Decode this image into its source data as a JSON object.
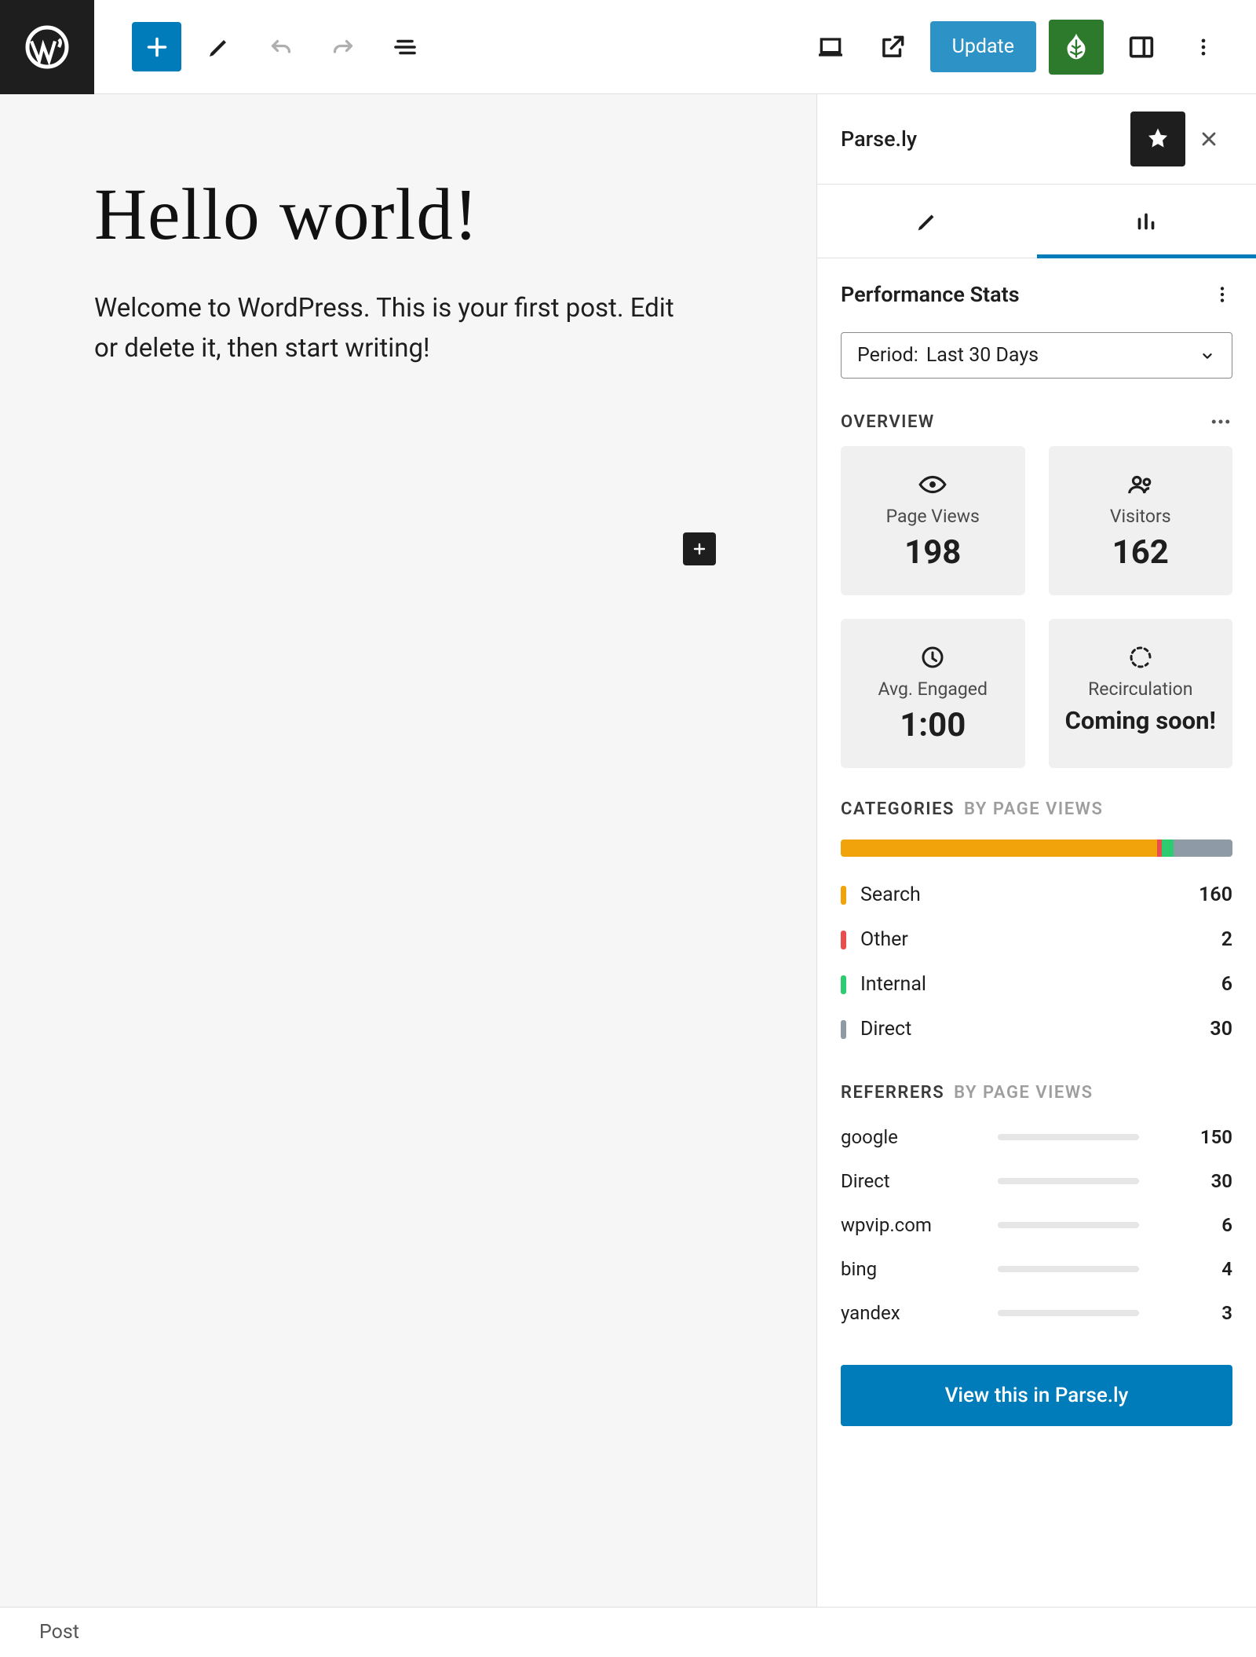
{
  "topbar": {
    "update_label": "Update"
  },
  "editor": {
    "title": "Hello world!",
    "body": "Welcome to WordPress. This is your first post. Edit or delete it, then start writing!"
  },
  "sidebar": {
    "title": "Parse.ly",
    "section_title": "Performance Stats",
    "period_label": "Period:",
    "period_value": "Last 30 Days",
    "overview_label": "OVERVIEW",
    "cards": {
      "page_views": {
        "label": "Page Views",
        "value": "198"
      },
      "visitors": {
        "label": "Visitors",
        "value": "162"
      },
      "avg_engaged": {
        "label": "Avg. Engaged",
        "value": "1:00"
      },
      "recirculation": {
        "label": "Recirculation",
        "value": "Coming soon!"
      }
    },
    "categories_label": "CATEGORIES",
    "categories_sub": "BY PAGE VIEWS",
    "categories": [
      {
        "name": "Search",
        "value": "160",
        "color": "#f0a30a",
        "frac": 0.808
      },
      {
        "name": "Other",
        "value": "2",
        "color": "#e94e4e",
        "frac": 0.011
      },
      {
        "name": "Internal",
        "value": "6",
        "color": "#2ecc71",
        "frac": 0.03
      },
      {
        "name": "Direct",
        "value": "30",
        "color": "#8e9aa6",
        "frac": 0.151
      }
    ],
    "referrers_label": "REFERRERS",
    "referrers_sub": "BY PAGE VIEWS",
    "referrers": [
      {
        "name": "google",
        "value": "150",
        "frac": 0.78
      },
      {
        "name": "Direct",
        "value": "30",
        "frac": 0.16
      },
      {
        "name": "wpvip.com",
        "value": "6",
        "frac": 0.032
      },
      {
        "name": "bing",
        "value": "4",
        "frac": 0.022
      },
      {
        "name": "yandex",
        "value": "3",
        "frac": 0.016
      }
    ],
    "view_button": "View this in Parse.ly"
  },
  "footer": {
    "breadcrumb": "Post"
  },
  "chart_data": [
    {
      "type": "bar",
      "title": "Categories by page views",
      "categories": [
        "Search",
        "Other",
        "Internal",
        "Direct"
      ],
      "values": [
        160,
        2,
        6,
        30
      ]
    },
    {
      "type": "bar",
      "title": "Referrers by page views",
      "categories": [
        "google",
        "Direct",
        "wpvip.com",
        "bing",
        "yandex"
      ],
      "values": [
        150,
        30,
        6,
        4,
        3
      ]
    }
  ]
}
